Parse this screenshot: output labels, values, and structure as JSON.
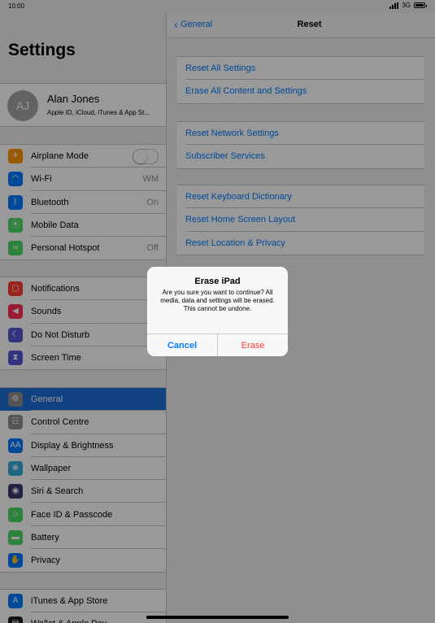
{
  "status": {
    "time": "10:00",
    "network": "3G"
  },
  "sidebar": {
    "title": "Settings",
    "profile": {
      "initials": "AJ",
      "name": "Alan Jones",
      "subtitle": "Apple ID, iCloud, iTunes & App St..."
    },
    "group1": [
      {
        "label": "Airplane Mode",
        "icon": "airplane-icon",
        "color": "#ff9500",
        "glyph": "✈",
        "toggle": true
      },
      {
        "label": "Wi-Fi",
        "icon": "wifi-icon",
        "color": "#007aff",
        "glyph": "◠",
        "value": "WM"
      },
      {
        "label": "Bluetooth",
        "icon": "bluetooth-icon",
        "color": "#007aff",
        "glyph": "ᛒ",
        "value": "On"
      },
      {
        "label": "Mobile Data",
        "icon": "antenna-icon",
        "color": "#4cd964",
        "glyph": "⦿"
      },
      {
        "label": "Personal Hotspot",
        "icon": "hotspot-icon",
        "color": "#4cd964",
        "glyph": "∞",
        "value": "Off"
      }
    ],
    "group2": [
      {
        "label": "Notifications",
        "icon": "notifications-icon",
        "color": "#ff3b30",
        "glyph": "▢"
      },
      {
        "label": "Sounds",
        "icon": "speaker-icon",
        "color": "#ff2d55",
        "glyph": "◀"
      },
      {
        "label": "Do Not Disturb",
        "icon": "moon-icon",
        "color": "#5856d6",
        "glyph": "☾"
      },
      {
        "label": "Screen Time",
        "icon": "hourglass-icon",
        "color": "#5856d6",
        "glyph": "⧗"
      }
    ],
    "group3": [
      {
        "label": "General",
        "icon": "gear-icon",
        "color": "#8e8e93",
        "glyph": "⚙",
        "selected": true
      },
      {
        "label": "Control Centre",
        "icon": "switches-icon",
        "color": "#8e8e93",
        "glyph": "☷"
      },
      {
        "label": "Display & Brightness",
        "icon": "text-size-icon",
        "color": "#007aff",
        "glyph": "AA"
      },
      {
        "label": "Wallpaper",
        "icon": "flower-icon",
        "color": "#34aadc",
        "glyph": "❀"
      },
      {
        "label": "Siri & Search",
        "icon": "siri-icon",
        "color": "#3a3a6e",
        "glyph": "◉"
      },
      {
        "label": "Face ID & Passcode",
        "icon": "face-id-icon",
        "color": "#4cd964",
        "glyph": "☺"
      },
      {
        "label": "Battery",
        "icon": "battery-icon",
        "color": "#4cd964",
        "glyph": "▬"
      },
      {
        "label": "Privacy",
        "icon": "hand-icon",
        "color": "#007aff",
        "glyph": "✋"
      }
    ],
    "group4": [
      {
        "label": "iTunes & App Store",
        "icon": "app-store-icon",
        "color": "#007aff",
        "glyph": "A"
      },
      {
        "label": "Wallet & Apple Pay",
        "icon": "wallet-icon",
        "color": "#1c1c1e",
        "glyph": "▤"
      }
    ]
  },
  "detail": {
    "back": "General",
    "title": "Reset",
    "groups": [
      [
        "Reset All Settings",
        "Erase All Content and Settings"
      ],
      [
        "Reset Network Settings",
        "Subscriber Services"
      ],
      [
        "Reset Keyboard Dictionary",
        "Reset Home Screen Layout",
        "Reset Location & Privacy"
      ]
    ]
  },
  "alert": {
    "title": "Erase iPad",
    "message": "Are you sure you want to continue? All media, data and settings will be erased.",
    "message2": "This cannot be undone.",
    "cancel": "Cancel",
    "confirm": "Erase"
  }
}
